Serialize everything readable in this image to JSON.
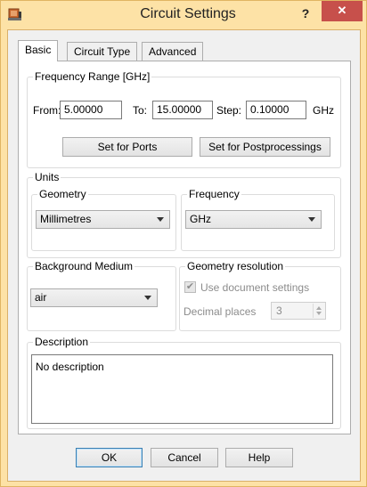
{
  "window": {
    "title": "Circuit Settings",
    "help_glyph": "?",
    "close_glyph": "✕"
  },
  "tabs": [
    {
      "label": "Basic",
      "active": true
    },
    {
      "label": "Circuit Type",
      "active": false
    },
    {
      "label": "Advanced",
      "active": false
    }
  ],
  "frequency_range": {
    "label": "Frequency Range [GHz]",
    "from_label": "From:",
    "from_value": "5.00000",
    "to_label": "To:",
    "to_value": "15.00000",
    "step_label": "Step:",
    "step_value": "0.10000",
    "unit": "GHz",
    "set_ports_label": "Set for Ports",
    "set_post_label": "Set for Postprocessings"
  },
  "units": {
    "label": "Units",
    "geometry_label": "Geometry",
    "geometry_value": "Millimetres",
    "frequency_label": "Frequency",
    "frequency_value": "GHz"
  },
  "background": {
    "label": "Background Medium",
    "value": "air"
  },
  "geometry_resolution": {
    "label": "Geometry resolution",
    "use_doc_label": "Use document settings",
    "use_doc_checked": true,
    "decimal_label": "Decimal places",
    "decimal_value": "3"
  },
  "description": {
    "label": "Description",
    "value": "No description"
  },
  "buttons": {
    "ok": "OK",
    "cancel": "Cancel",
    "help": "Help"
  },
  "icons": {
    "app": "circuit-app-icon",
    "check": "checkmark-icon",
    "dropdown": "chevron-down-icon"
  },
  "colors": {
    "titlebar": "#fde2a6",
    "close": "#c7504b",
    "default_border": "#3c7fb1"
  }
}
